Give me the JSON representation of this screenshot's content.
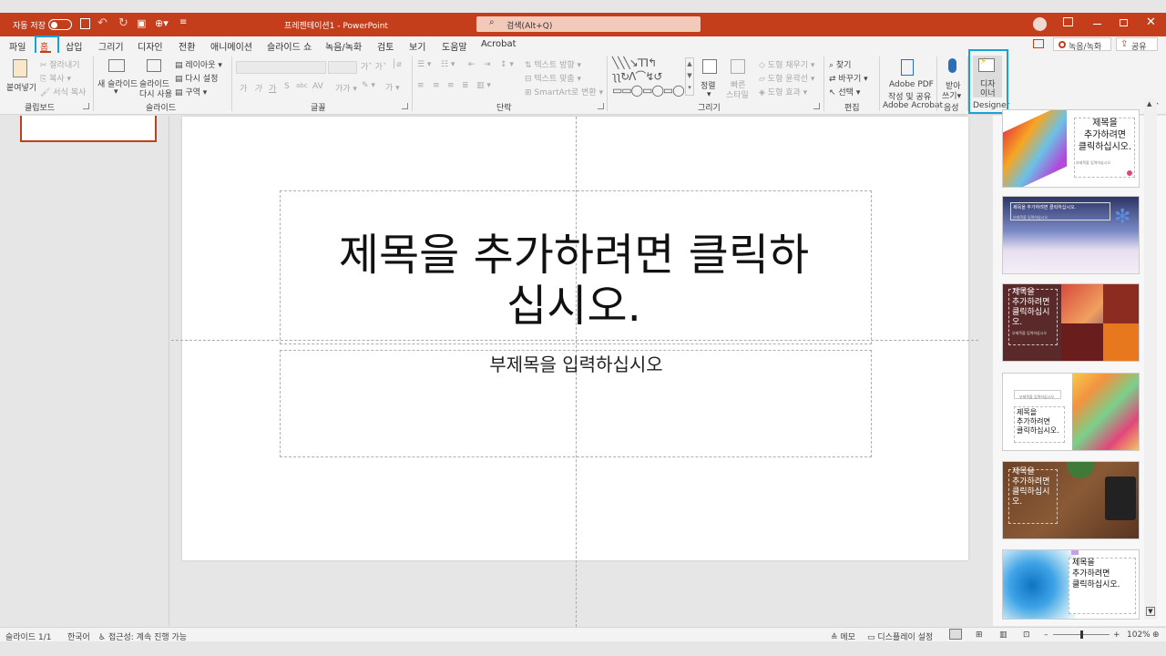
{
  "titlebar": {
    "autosave_label": "자동 저장",
    "toggle_state": "끔",
    "doc_title": "프레젠테이션1 - PowerPoint",
    "search_placeholder": "검색(Alt+Q)"
  },
  "tabs": [
    "파일",
    "홈",
    "삽입",
    "그리기",
    "디자인",
    "전환",
    "애니메이션",
    "슬라이드 쇼",
    "녹음/녹화",
    "검토",
    "보기",
    "도움말",
    "Acrobat"
  ],
  "active_tab": "홈",
  "tab_right": {
    "record_button": "녹음/녹화",
    "share_button": "공유"
  },
  "ribbon": {
    "clipboard": {
      "paste": "붙여넣기",
      "cut": "잘라내기",
      "copy": "복사",
      "format_painter": "서식 복사",
      "group": "클립보드"
    },
    "slides": {
      "new_slide": "새 슬라이드",
      "reuse_slide_1": "슬라이드",
      "reuse_slide_2": "다시 사용",
      "layout": "레이아웃",
      "reset": "다시 설정",
      "section": "구역",
      "group": "슬라이드"
    },
    "font": {
      "group": "글꼴",
      "buttons": [
        "가",
        "가",
        "가",
        "S",
        "abc",
        "AV"
      ]
    },
    "paragraph": {
      "text_direction": "텍스트 방향",
      "align_text": "텍스트 맞춤",
      "smartart": "SmartArt로 변환",
      "group": "단락"
    },
    "drawing": {
      "arrange": "정렬",
      "quick_styles_1": "빠른",
      "quick_styles_2": "스타일",
      "shape_fill": "도형 채우기",
      "shape_outline": "도형 윤곽선",
      "shape_effects": "도형 효과",
      "group": "그리기"
    },
    "editing": {
      "find": "찾기",
      "replace": "바꾸기",
      "select": "선택",
      "group": "편집"
    },
    "acrobat": {
      "create_pdf_1": "Adobe PDF",
      "create_pdf_2": "작성 및 공유",
      "group": "Adobe Acrobat"
    },
    "voice": {
      "dictate_1": "받아",
      "dictate_2": "쓰기",
      "group": "음성"
    },
    "designer": {
      "label_1": "디자",
      "label_2": "이너",
      "group": "Designer"
    }
  },
  "slide": {
    "title_line1": "제목을 추가하려면 클릭하",
    "title_line2": "십시오.",
    "subtitle": "부제목을 입력하십시오"
  },
  "designer_thumbs": [
    {
      "text": "제목을 추가하려면 클릭하십시오.",
      "sub": "부제목을 입력하십시오"
    },
    {
      "text": "제목을 추가하려면 클릭하십시오.",
      "sub": "부제목을 입력하십시오"
    },
    {
      "text": "제목을 추가하려면 클릭하십시오.",
      "sub": "부제목을 입력하십시오"
    },
    {
      "text": "제목을 추가하려면 클릭하십시오.",
      "sub": "부제목을 입력하십시오"
    },
    {
      "text": "제목을 추가하려면 클릭하십시오.",
      "sub": ""
    },
    {
      "text": "제목을 추가하려면 클릭하십시오.",
      "sub": ""
    }
  ],
  "designer_thumb_lines": {
    "t1": [
      "제목을",
      "추가하려면",
      "클릭하십시오."
    ],
    "t3": [
      "제목을",
      "추가하려면",
      "클릭하십시",
      "오."
    ],
    "t4": [
      "제목을",
      "추가하려면",
      "클릭하십시오."
    ],
    "t5": [
      "제목을",
      "추가하려면",
      "클릭하십시",
      "오."
    ],
    "t6": [
      "제목을",
      "추가하려면",
      "클릭하십시오."
    ]
  },
  "statusbar": {
    "slide_count": "슬라이드 1/1",
    "language": "한국어",
    "accessibility": "접근성: 계속 진행 가능",
    "notes": "메모",
    "display_settings": "디스플레이 설정",
    "zoom": "102%"
  },
  "colors": {
    "accent": "#c43e1c",
    "highlight": "#1aa1d6"
  }
}
